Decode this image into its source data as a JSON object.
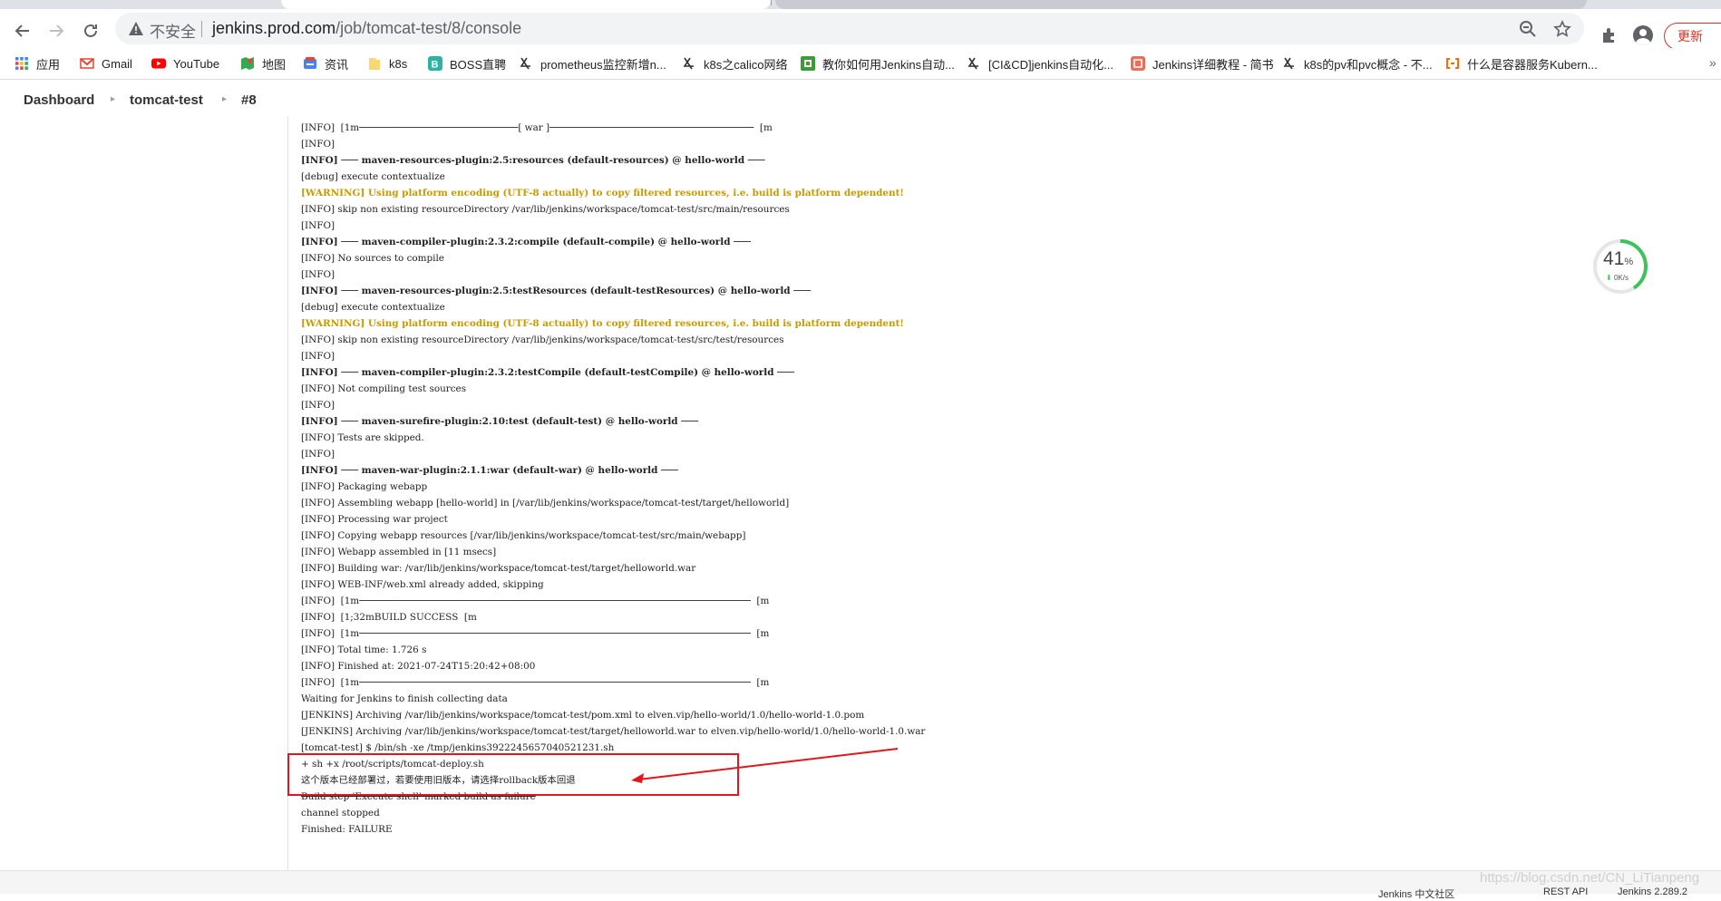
{
  "browser": {
    "url_warning": "不安全",
    "url_host": "jenkins.prod.com",
    "url_path": "/job/tomcat-test/8/console",
    "update_button": "更新"
  },
  "bookmarks": [
    {
      "label": "应用",
      "icon": "apps-grid-icon"
    },
    {
      "label": "Gmail",
      "icon": "gmail-icon"
    },
    {
      "label": "YouTube",
      "icon": "youtube-icon"
    },
    {
      "label": "地图",
      "icon": "maps-icon"
    },
    {
      "label": "资讯",
      "icon": "news-icon"
    },
    {
      "label": "k8s",
      "icon": "folder-icon"
    },
    {
      "label": "BOSS直聘",
      "icon": "boss-icon"
    },
    {
      "label": "prometheus监控新增n...",
      "icon": "site-icon"
    },
    {
      "label": "k8s之calico网络",
      "icon": "site-icon"
    },
    {
      "label": "教你如何用Jenkins自动...",
      "icon": "site-green-icon"
    },
    {
      "label": "[CI&CD]jenkins自动化...",
      "icon": "site-icon"
    },
    {
      "label": "Jenkins详细教程 - 简书",
      "icon": "jianshu-icon"
    },
    {
      "label": "k8s的pv和pvc概念 - 不...",
      "icon": "site-icon"
    },
    {
      "label": "什么是容器服务Kubern...",
      "icon": "aliyun-icon"
    }
  ],
  "breadcrumbs": [
    "Dashboard",
    "tomcat-test",
    "#8"
  ],
  "speed_widget": {
    "percent": "41",
    "percent_sign": "%",
    "rate": "0K/s"
  },
  "console_lines": [
    {
      "text": "[INFO]  [1m────────────────────────────[ war ]────────────────────────────────────  [m",
      "style": ""
    },
    {
      "text": "[INFO]",
      "style": ""
    },
    {
      "text": "[INFO] ─── maven-resources-plugin:2.5:resources (default-resources) @ hello-world ───",
      "style": "bold"
    },
    {
      "text": "[debug] execute contextualize",
      "style": ""
    },
    {
      "text": "[WARNING] Using platform encoding (UTF-8 actually) to copy filtered resources, i.e. build is platform dependent!",
      "style": "warn"
    },
    {
      "text": "[INFO] skip non existing resourceDirectory /var/lib/jenkins/workspace/tomcat-test/src/main/resources",
      "style": ""
    },
    {
      "text": "[INFO]",
      "style": ""
    },
    {
      "text": "[INFO] ─── maven-compiler-plugin:2.3.2:compile (default-compile) @ hello-world ───",
      "style": "bold"
    },
    {
      "text": "[INFO] No sources to compile",
      "style": ""
    },
    {
      "text": "[INFO]",
      "style": ""
    },
    {
      "text": "[INFO] ─── maven-resources-plugin:2.5:testResources (default-testResources) @ hello-world ───",
      "style": "bold"
    },
    {
      "text": "[debug] execute contextualize",
      "style": ""
    },
    {
      "text": "[WARNING] Using platform encoding (UTF-8 actually) to copy filtered resources, i.e. build is platform dependent!",
      "style": "warn"
    },
    {
      "text": "[INFO] skip non existing resourceDirectory /var/lib/jenkins/workspace/tomcat-test/src/test/resources",
      "style": ""
    },
    {
      "text": "[INFO]",
      "style": ""
    },
    {
      "text": "[INFO] ─── maven-compiler-plugin:2.3.2:testCompile (default-testCompile) @ hello-world ───",
      "style": "bold"
    },
    {
      "text": "[INFO] Not compiling test sources",
      "style": ""
    },
    {
      "text": "[INFO]",
      "style": ""
    },
    {
      "text": "[INFO] ─── maven-surefire-plugin:2.10:test (default-test) @ hello-world ───",
      "style": "bold"
    },
    {
      "text": "[INFO] Tests are skipped.",
      "style": ""
    },
    {
      "text": "[INFO]",
      "style": ""
    },
    {
      "text": "[INFO] ─── maven-war-plugin:2.1.1:war (default-war) @ hello-world ───",
      "style": "bold"
    },
    {
      "text": "[INFO] Packaging webapp",
      "style": ""
    },
    {
      "text": "[INFO] Assembling webapp [hello-world] in [/var/lib/jenkins/workspace/tomcat-test/target/helloworld]",
      "style": ""
    },
    {
      "text": "[INFO] Processing war project",
      "style": ""
    },
    {
      "text": "[INFO] Copying webapp resources [/var/lib/jenkins/workspace/tomcat-test/src/main/webapp]",
      "style": ""
    },
    {
      "text": "[INFO] Webapp assembled in [11 msecs]",
      "style": ""
    },
    {
      "text": "[INFO] Building war: /var/lib/jenkins/workspace/tomcat-test/target/helloworld.war",
      "style": ""
    },
    {
      "text": "[INFO] WEB-INF/web.xml already added, skipping",
      "style": ""
    },
    {
      "text": "[INFO]  [1m─────────────────────────────────────────────────────────────────────  [m",
      "style": ""
    },
    {
      "text": "[INFO]  [1;32mBUILD SUCCESS  [m",
      "style": ""
    },
    {
      "text": "[INFO]  [1m─────────────────────────────────────────────────────────────────────  [m",
      "style": ""
    },
    {
      "text": "[INFO] Total time: 1.726 s",
      "style": ""
    },
    {
      "text": "[INFO] Finished at: 2021-07-24T15:20:42+08:00",
      "style": ""
    },
    {
      "text": "[INFO]  [1m─────────────────────────────────────────────────────────────────────  [m",
      "style": ""
    },
    {
      "text": "Waiting for Jenkins to finish collecting data",
      "style": ""
    },
    {
      "text": "[JENKINS] Archiving /var/lib/jenkins/workspace/tomcat-test/pom.xml to elven.vip/hello-world/1.0/hello-world-1.0.pom",
      "style": ""
    },
    {
      "text": "[JENKINS] Archiving /var/lib/jenkins/workspace/tomcat-test/target/helloworld.war to elven.vip/hello-world/1.0/hello-world-1.0.war",
      "style": ""
    },
    {
      "text": "[tomcat-test] $ /bin/sh -xe /tmp/jenkins3922245657040521231.sh",
      "style": ""
    },
    {
      "text": "+ sh +x /root/scripts/tomcat-deploy.sh",
      "style": ""
    },
    {
      "text": "这个版本已经部署过，若要使用旧版本，请选择rollback版本回退",
      "style": ""
    },
    {
      "text": "Build step 'Execute shell' marked build as failure",
      "style": "strike"
    },
    {
      "text": "channel stopped",
      "style": ""
    },
    {
      "text": "Finished: FAILURE",
      "style": ""
    }
  ],
  "watermark": "https://blog.csdn.net/CN_LiTianpeng",
  "footer": {
    "community": "Jenkins 中文社区",
    "rest_api": "REST API",
    "version": "Jenkins 2.289.2"
  }
}
